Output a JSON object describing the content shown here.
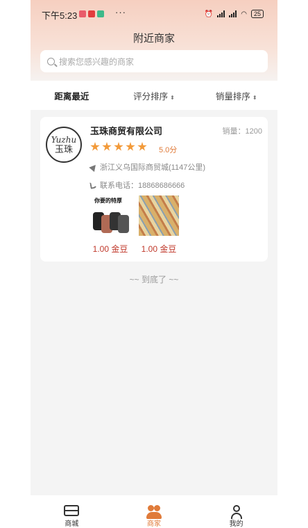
{
  "status_bar": {
    "time": "下午5:23",
    "dots": "···",
    "battery": "25"
  },
  "header": {
    "title": "附近商家"
  },
  "search": {
    "placeholder": "搜索您感兴趣的商家"
  },
  "sort": {
    "distance": "距离最近",
    "rating": "评分排序",
    "sales": "销量排序",
    "arrow": "⬍"
  },
  "shop": {
    "logo_line1": "Yuzhu",
    "logo_line2": "玉珠",
    "name": "玉珠商贸有限公司",
    "sales": "销量：1200",
    "rating": 5,
    "score": "5.0分",
    "address": "浙江义乌国际商贸城(1147公里)",
    "phone": "联系电话：18868686666",
    "products": [
      {
        "label": "你要的特厚",
        "price": "1.00 金豆"
      },
      {
        "label": "",
        "price": "1.00 金豆"
      }
    ]
  },
  "end_text": "~~  到底了  ~~",
  "tabs": [
    {
      "label": "商城",
      "icon": "store-icon"
    },
    {
      "label": "商家",
      "icon": "merchants-icon"
    },
    {
      "label": "我的",
      "icon": "profile-icon"
    }
  ],
  "colors": {
    "accent": "#e07b3a",
    "price": "#c0392b",
    "star": "#f29a3a"
  }
}
